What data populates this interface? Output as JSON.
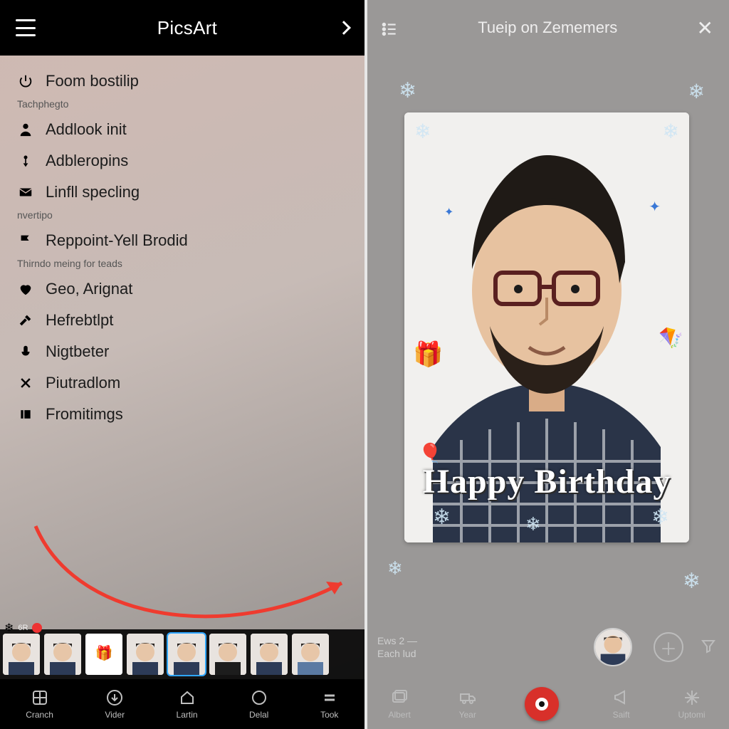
{
  "left": {
    "title": "PicsArt",
    "menu": [
      {
        "icon": "power-icon",
        "label": "Foom bostilip"
      },
      {
        "caption": "Tachphegto"
      },
      {
        "icon": "person-icon",
        "label": "Addlook init"
      },
      {
        "icon": "pin-icon",
        "label": "Adbleropins"
      },
      {
        "icon": "mail-icon",
        "label": "Linfll specling"
      },
      {
        "caption": "nvertipo"
      },
      {
        "icon": "flag-icon",
        "label": "Reppoint-Yell Brodid"
      },
      {
        "caption": "Thirndo meing for teads"
      },
      {
        "icon": "heart-icon",
        "label": "Geo, Arignat"
      },
      {
        "icon": "hammer-icon",
        "label": "Hefrebtlpt"
      },
      {
        "icon": "mic-icon",
        "label": "Nigtbeter"
      },
      {
        "icon": "x-icon",
        "label": "Piutradlom"
      },
      {
        "icon": "clip-icon",
        "label": "Fromitimgs"
      }
    ],
    "badge_text": "6R",
    "nav": [
      {
        "icon": "grid-icon",
        "label": "Cranch"
      },
      {
        "icon": "download-icon",
        "label": "Vider"
      },
      {
        "icon": "home-icon",
        "label": "Lartin"
      },
      {
        "icon": "circle-icon",
        "label": "Delal"
      },
      {
        "icon": "equals-icon",
        "label": "Took"
      }
    ]
  },
  "right": {
    "title": "Tueip on Zememers",
    "overlay_text": "Happy Birthday",
    "strip": {
      "line1": "Ews 2",
      "line2": "Each lud",
      "dash": "—"
    },
    "nav": [
      {
        "icon": "photos-icon",
        "label": "Albert"
      },
      {
        "icon": "truck-icon",
        "label": "Year"
      },
      {
        "icon": "record-icon",
        "label": ""
      },
      {
        "icon": "megaphone-icon",
        "label": "Saift"
      },
      {
        "icon": "star-icon",
        "label": "Uptomi"
      }
    ]
  }
}
